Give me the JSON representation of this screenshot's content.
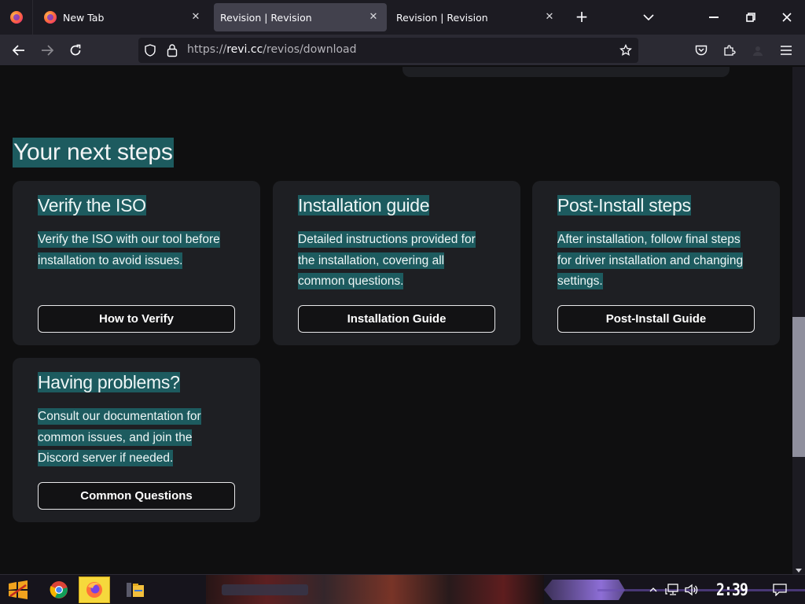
{
  "browser": {
    "tabs": [
      {
        "label": "New Tab",
        "icon": "firefox-icon",
        "active": false
      },
      {
        "label": "Revision | Revision",
        "active": true
      },
      {
        "label": "Revision | Revision",
        "active": false
      }
    ],
    "url": {
      "scheme": "https://",
      "host": "revi.cc",
      "path": "/revios/download"
    }
  },
  "page": {
    "section_title": "Your next steps",
    "cards": [
      {
        "title": "Verify the ISO",
        "description_lines": [
          "Verify the ISO with our tool before",
          "installation to avoid issues."
        ],
        "button": "How to Verify"
      },
      {
        "title": "Installation guide",
        "description_lines": [
          "Detailed instructions provided for",
          "the installation, covering all",
          "common questions."
        ],
        "button": "Installation Guide"
      },
      {
        "title": "Post-Install steps",
        "description_lines": [
          "After installation, follow final steps",
          "for driver installation and changing",
          "settings."
        ],
        "button": "Post-Install Guide"
      },
      {
        "title": "Having problems?",
        "description_lines": [
          "Consult our documentation for",
          "common issues, and join the",
          "Discord server if needed."
        ],
        "button": "Common Questions"
      }
    ]
  },
  "taskbar": {
    "apps": [
      "start-icon",
      "chrome-icon",
      "firefox-icon",
      "file-explorer-icon"
    ],
    "clock": "2:39 AM"
  },
  "colors": {
    "selection_highlight": "#1d5b5f",
    "card_background": "#1e1f23",
    "page_background": "#0f0f10",
    "active_tab": "#42414d",
    "taskbar_active_app": "#f6d83c"
  }
}
